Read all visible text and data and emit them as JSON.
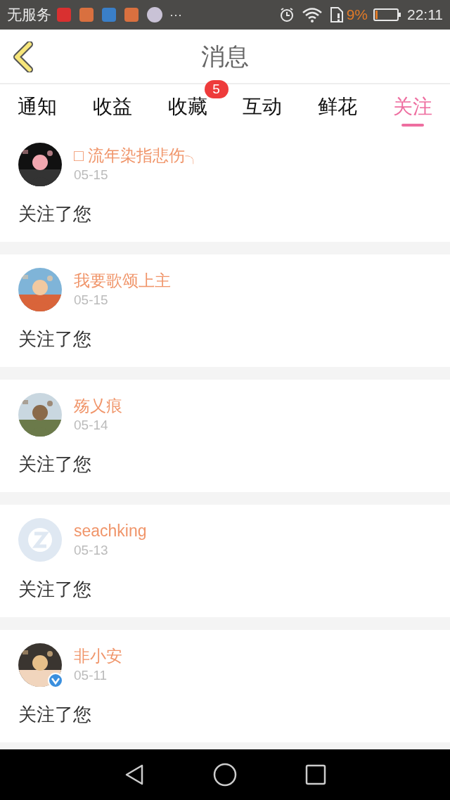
{
  "status_bar": {
    "carrier": "无服务",
    "more": "···",
    "battery_percent": "9%",
    "time": "22:11"
  },
  "header": {
    "title": "消息"
  },
  "tabs": [
    {
      "label": "通知",
      "selected": false
    },
    {
      "label": "收益",
      "selected": false
    },
    {
      "label": "收藏",
      "selected": false,
      "badge": "5"
    },
    {
      "label": "互动",
      "selected": false
    },
    {
      "label": "鲜花",
      "selected": false
    },
    {
      "label": "关注",
      "selected": true
    }
  ],
  "messages": [
    {
      "name": "□ 流年染指悲伤╮",
      "date": "05-15",
      "text": "关注了您",
      "kind": "picture",
      "verified": false
    },
    {
      "name": "我要歌颂上主",
      "date": "05-15",
      "text": "关注了您",
      "kind": "picture",
      "verified": false
    },
    {
      "name": "殇乂痕",
      "date": "05-14",
      "text": "关注了您",
      "kind": "picture",
      "verified": false
    },
    {
      "name": "seachking",
      "date": "05-13",
      "text": "关注了您",
      "kind": "default",
      "verified": false
    },
    {
      "name": "非小安",
      "date": "05-11",
      "text": "关注了您",
      "kind": "picture",
      "verified": true
    }
  ]
}
